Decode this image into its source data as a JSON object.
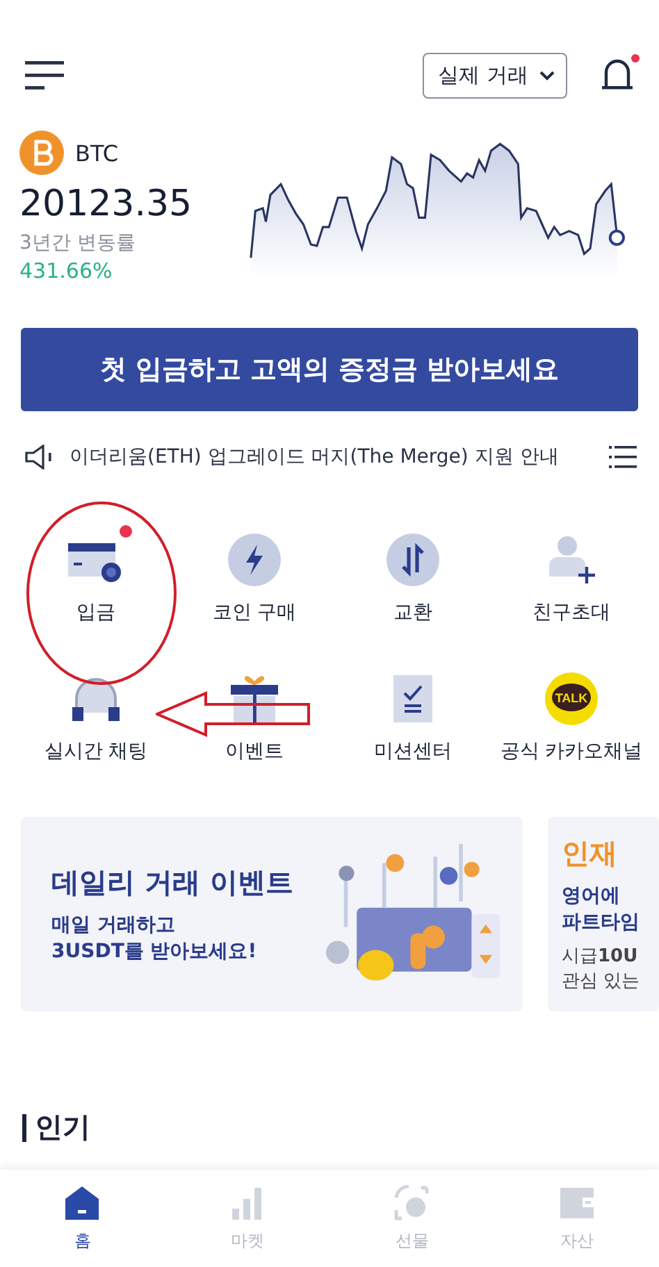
{
  "header": {
    "mode_selector": "실제 거래",
    "notification_dot": true
  },
  "ticker": {
    "symbol": "BTC",
    "price": "20123.35",
    "change_label": "3년간 변동률",
    "change": "431.66%"
  },
  "promo_button": "첫 입금하고 고액의 증정금 받아보세요",
  "notice": {
    "text": "이더리움(ETH) 업그레이드 머지(The Merge) 지원 안내"
  },
  "shortcuts": [
    {
      "kind": "deposit",
      "label": "입금",
      "badge": true
    },
    {
      "kind": "bolt",
      "label": "코인 구매",
      "badge": false
    },
    {
      "kind": "swap",
      "label": "교환",
      "badge": false
    },
    {
      "kind": "invite",
      "label": "친구초대",
      "badge": false
    },
    {
      "kind": "headset",
      "label": "실시간 채팅",
      "badge": false
    },
    {
      "kind": "gift",
      "label": "이벤트",
      "badge": false
    },
    {
      "kind": "checklist",
      "label": "미션센터",
      "badge": false
    },
    {
      "kind": "talk",
      "label": "공식 카카오채널",
      "badge": false,
      "icon_text": "TALK"
    }
  ],
  "banners": [
    {
      "title": "데일리 거래 이벤트",
      "lines": [
        "매일 거래하고",
        "**3USDT**를 받아보세요!"
      ]
    },
    {
      "title": "인재",
      "lines": [
        "영어에",
        "파트타임"
      ],
      "extra": [
        "시급**10U**",
        "관심 있는"
      ]
    }
  ],
  "section_title": "인기",
  "nav": [
    {
      "kind": "home",
      "label": "홈",
      "selected": true
    },
    {
      "kind": "market",
      "label": "마켓",
      "selected": false
    },
    {
      "kind": "futures",
      "label": "선물",
      "selected": false
    },
    {
      "kind": "assets",
      "label": "자산",
      "selected": false
    }
  ]
}
